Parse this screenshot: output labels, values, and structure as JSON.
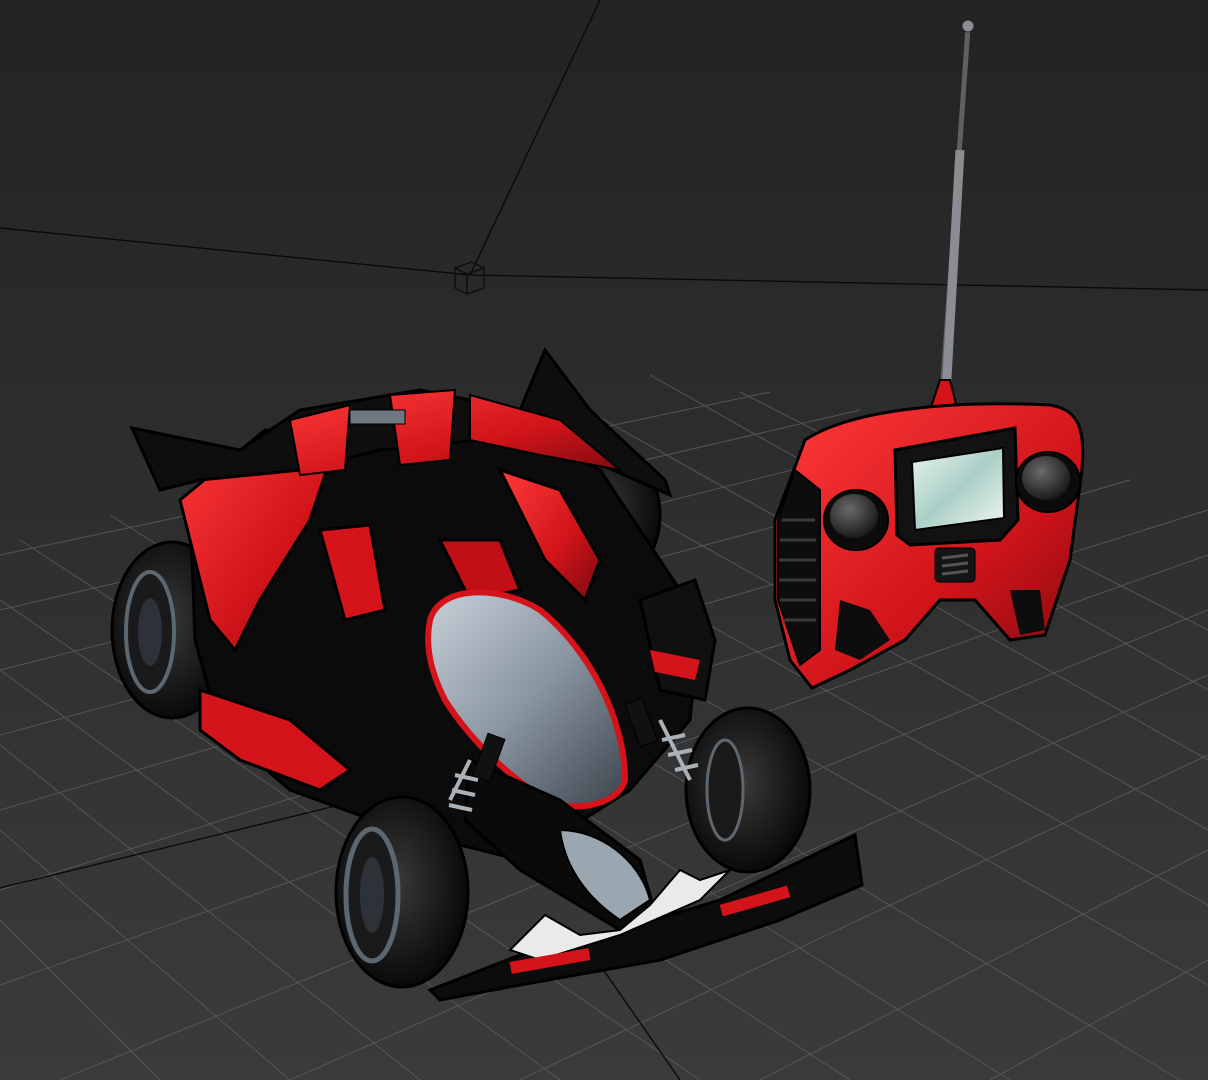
{
  "viewport": {
    "background_top": "#262626",
    "background_bottom": "#3a3a3a",
    "grid_color": "#5b5b5b",
    "axis_color": "#0a0a0a"
  },
  "scene": {
    "objects": [
      {
        "name": "rc-car",
        "colors": {
          "body": "#d4141a",
          "shell": "#0b0b0b",
          "canopy": "#8e9aa6"
        }
      },
      {
        "name": "rc-remote-controller",
        "colors": {
          "body": "#d4141a",
          "screen": "#cfe6e0",
          "knobs": "#2a2a2a"
        }
      }
    ],
    "helpers": [
      "camera-target-box-icon"
    ]
  }
}
